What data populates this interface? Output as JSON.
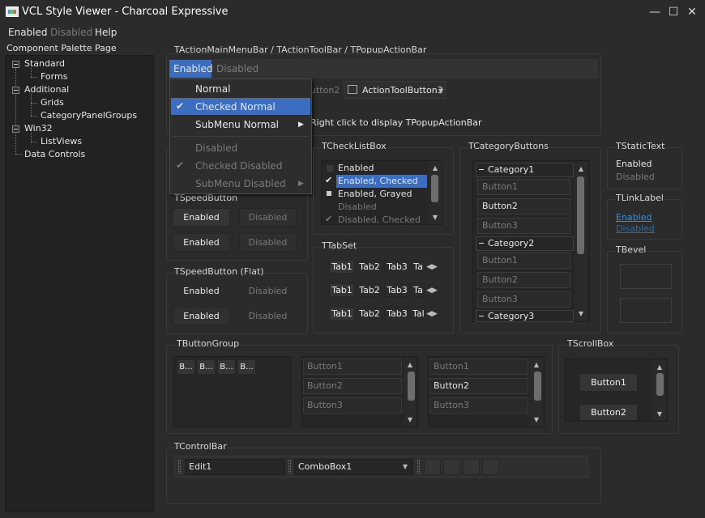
{
  "window": {
    "title": "VCL Style Viewer - Charcoal Expressive",
    "controls": {
      "minimize": "—",
      "maximize": "☐",
      "close": "✕"
    }
  },
  "menubar": [
    "Enabled",
    "Disabled",
    "Help"
  ],
  "palette": {
    "title": "Component Palette Page",
    "tree": [
      "Standard",
      "Forms",
      "Additional",
      "Grids",
      "CategoryPanelGroups",
      "Win32",
      "ListViews",
      "Data Controls"
    ]
  },
  "action_bar": {
    "label": "TActionMainMenuBar / TActionToolBar / TPopupActionBar",
    "menu_enabled": "Enabled",
    "menu_disabled": "Disabled",
    "toolbar_btn2": "utton2",
    "toolbar_btn3": "ActionToolButton3",
    "hint": "Right click to display TPopupActionBar"
  },
  "popup_menu": {
    "items": [
      "Normal",
      "Checked Normal",
      "SubMenu Normal",
      "Disabled",
      "Checked Disabled",
      "SubMenu Disabled"
    ]
  },
  "speed_button": {
    "label": "TSpeedButton",
    "enabled": "Enabled",
    "disabled": "Disabled"
  },
  "speed_button_flat": {
    "label": "TSpeedButton (Flat)",
    "enabled": "Enabled",
    "disabled": "Disabled"
  },
  "checklistbox": {
    "label": "TCheckListBox",
    "items": [
      "Enabled",
      "Enabled, Checked",
      "Enabled, Grayed",
      "Disabled",
      "Disabled, Checked"
    ]
  },
  "tabset": {
    "label": "TTabSet",
    "rows": [
      [
        "Tab1",
        "Tab2",
        "Tab3",
        "Ta"
      ],
      [
        "Tab1",
        "Tab2",
        "Tab3",
        "Ta"
      ],
      [
        "Tab1",
        "Tab2",
        "Tab3",
        "Tal"
      ]
    ]
  },
  "category_buttons": {
    "label": "TCategoryButtons",
    "categories": [
      {
        "name": "Category1",
        "buttons": [
          "Button1",
          "Button2",
          "Button3"
        ]
      },
      {
        "name": "Category2",
        "buttons": [
          "Button1",
          "Button2",
          "Button3"
        ]
      },
      {
        "name": "Category3",
        "buttons": []
      }
    ]
  },
  "static_text": {
    "label": "TStaticText",
    "enabled": "Enabled",
    "disabled": "Disabled"
  },
  "link_label": {
    "label": "TLinkLabel",
    "enabled": "Enabled",
    "disabled": "Disabled"
  },
  "bevel": {
    "label": "TBevel"
  },
  "button_group": {
    "label": "TButtonGroup",
    "small_buttons": [
      "B...",
      "B...",
      "B...",
      "B..."
    ],
    "list1": [
      "Button1",
      "Button2",
      "Button3"
    ],
    "list2": [
      "Button1",
      "Button2",
      "Button3"
    ]
  },
  "scroll_box": {
    "label": "TScrollBox",
    "buttons": [
      "Button1",
      "Button2"
    ]
  },
  "control_bar": {
    "label": "TControlBar",
    "edit": "Edit1",
    "combo": "ComboBox1"
  }
}
